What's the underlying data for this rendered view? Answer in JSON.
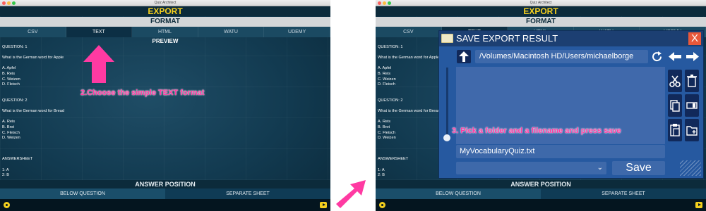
{
  "window": {
    "title": "Quiz Architect"
  },
  "header": {
    "export": "EXPORT",
    "format": "FORMAT"
  },
  "format_tabs": [
    {
      "label": "CSV"
    },
    {
      "label": "TEXT"
    },
    {
      "label": "HTML"
    },
    {
      "label": "WATU"
    },
    {
      "label": "UDEMY"
    }
  ],
  "preview": {
    "title": "PREVIEW",
    "text": "QUESTION: 1\n\nWhat is the German word for Apple\n\nA. Apfel\nB. Reis\nC. Weizen\nD. Fleisch\n\n\nQUESTION: 2\n\nWhat is the German word for Bread\n\nA. Reis\nB. Brot\nC. Fleisch\nD. Weizen\n\n\n\nANSWERSHEET\n\n1: A\n2: B"
  },
  "answer_position": {
    "title": "ANSWER POSITION",
    "options": [
      {
        "label": "BELOW QUESTION"
      },
      {
        "label": "SEPARATE SHEET"
      }
    ]
  },
  "annotations": {
    "step2": "2.Choose the simple TEXT format",
    "step3": "3. Pick a folder and a filename and press save"
  },
  "dialog": {
    "title": "SAVE EXPORT RESULT",
    "close": "X",
    "path": "/Volumes/Macintosh HD/Users/michaelborge",
    "filename": "MyVocabularyQuiz.txt",
    "save_label": "Save"
  },
  "colors": {
    "accent_yellow": "#f3cf1e",
    "annotation_pink": "#ff3aa2",
    "dialog_blue": "#2659a0",
    "close_red": "#e8583b"
  }
}
